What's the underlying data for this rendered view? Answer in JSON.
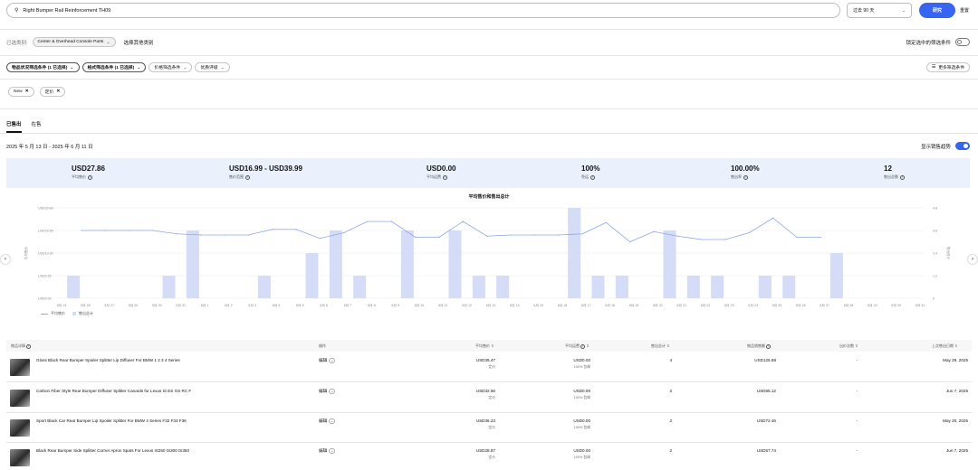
{
  "search": {
    "query": "Right Bumper Rail Reinforcement TH09",
    "period": "过去 90 天",
    "search_button": "研究",
    "reset": "重置"
  },
  "category": {
    "label": "已选类别:",
    "selected": "Center & Overhead Console Parts",
    "more": "选择其他类别",
    "lock_label": "锁定选中的筛选条件"
  },
  "filters": {
    "items": [
      "物品状况筛选条件 (1 已选择)",
      "格式筛选条件 (1 已选择)",
      "价格筛选条件",
      "优质评级"
    ],
    "more": "更多筛选条件"
  },
  "chips": [
    "New",
    "定价"
  ],
  "tabs": [
    "已售出",
    "在售"
  ],
  "date_range": "2025 年 5 月 13 日 - 2025 年 6 月 11 日",
  "show_range_label": "显示销售趋势",
  "stats": [
    {
      "value": "USD27.86",
      "label": "平均售价"
    },
    {
      "value": "USD16.99 - USD39.99",
      "label": "售价范围"
    },
    {
      "value": "USD0.00",
      "label": "平均运费"
    },
    {
      "value": "100%",
      "label": "免运"
    },
    {
      "value": "100.00%",
      "label": "售出率"
    },
    {
      "value": "12",
      "label": "售出总数"
    }
  ],
  "chart_data": {
    "type": "bar",
    "title": "平均售价和售出总计",
    "categories": [
      "5月 13",
      "5月 25",
      "5月 27",
      "5月 29",
      "5月 30",
      "5月 31",
      "6月 1",
      "6月 2",
      "6月 3",
      "6月 4",
      "6月 5",
      "6月 6",
      "6月 7",
      "6月 8",
      "6月 9",
      "6月 10",
      "6月 11",
      "6月 12",
      "6月 13",
      "6月 14",
      "6月 15",
      "6月 16",
      "6月 17",
      "6月 18",
      "6月 19",
      "6月 20",
      "6月 21",
      "6月 22",
      "6月 23",
      "6月 24",
      "6月 25",
      "6月 26",
      "6月 27",
      "6月 28",
      "6月 29",
      "6月 30",
      "6月 31"
    ],
    "series": [
      {
        "name": "售出总计",
        "axis": "right",
        "values": [
          1,
          0,
          0,
          0,
          1,
          3,
          0,
          0,
          1,
          0,
          2,
          3,
          1,
          0,
          3,
          0,
          3,
          1,
          1,
          0,
          0,
          4,
          1,
          1,
          0,
          3,
          1,
          1,
          0,
          1,
          1,
          0,
          2,
          0,
          0,
          0,
          0
        ]
      },
      {
        "name": "平均售价",
        "axis": "left",
        "values": [
          30,
          30,
          30,
          30,
          28.5,
          28,
          28,
          28,
          30.5,
          30.5,
          26.5,
          29,
          34,
          34,
          27,
          27,
          34,
          27.5,
          28,
          28,
          28,
          28.5,
          33.5,
          25,
          29.5,
          27.5,
          26,
          26,
          29,
          35.5,
          27,
          27
        ]
      }
    ],
    "ylim_left": [
      0,
      40
    ],
    "ylim_right": [
      0,
      4
    ],
    "y_ticks_left": [
      "USD0.00",
      "USD9.95",
      "USD19.90",
      "USD29.85",
      "USD39.80"
    ],
    "y_ticks_right": [
      "0",
      "1.2",
      "2.4",
      "3.6",
      "4.8"
    ],
    "ylabel_left": "平均售价",
    "ylabel_right": "售出总计"
  },
  "table": {
    "headers": [
      "物品详情",
      "操作",
      "平均售价",
      "平均运费",
      "售出总计",
      "物品销售额",
      "出价次数",
      "上次售出日期"
    ],
    "edit_label": "编辑",
    "rows": [
      {
        "title": "Gloss Black Rear Bumper Spoiler Splitter Lip Diffuser For BMW 1 2 3 4 Series",
        "price": "USD35.47",
        "price_sub": "定价",
        "ship": "USD0.00",
        "ship_sub": "100% 包邮",
        "sold": "4",
        "sales": "USD125.88",
        "bids": "-",
        "date": "May 29, 2025"
      },
      {
        "title": "Carbon Fiber Style Rear Bumper Diffuser Splitter Canards for Lexus IS ES GS RC F",
        "price": "USD32.56",
        "price_sub": "定价",
        "ship": "USD0.00",
        "ship_sub": "100% 包邮",
        "sold": "2",
        "sales": "USD65.12",
        "bids": "-",
        "date": "Jun 7, 2025"
      },
      {
        "title": "Sport Black Car Rear Bumper Lip Spoiler Splitter For BMW 4 Series F32 F33 F36",
        "price": "USD36.23",
        "price_sub": "定价",
        "ship": "USD0.00",
        "ship_sub": "100% 包邮",
        "sold": "2",
        "sales": "USD72.46",
        "bids": "-",
        "date": "May 20, 2025"
      },
      {
        "title": "Black Rear Bumper Side Splitter Corner Apron Spats For Lexus IS250 IS300 IS350",
        "price": "USD28.87",
        "price_sub": "定价",
        "ship": "USD0.00",
        "ship_sub": "100% 包邮",
        "sold": "2",
        "sales": "USD57.74",
        "bids": "-",
        "date": "Jun 7, 2025"
      }
    ]
  }
}
